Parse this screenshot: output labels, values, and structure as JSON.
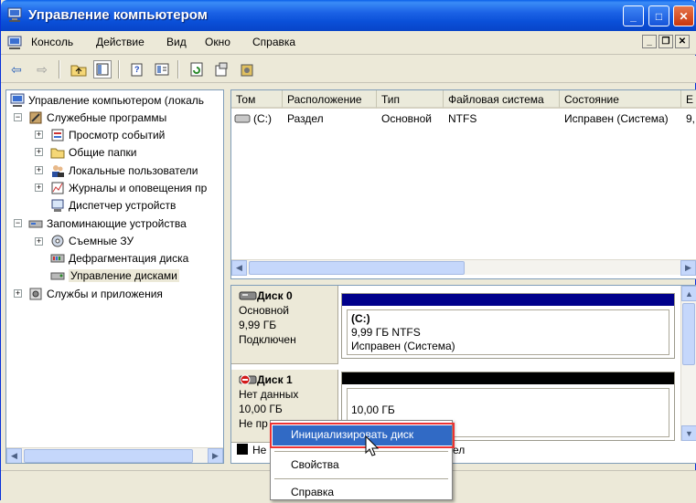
{
  "window": {
    "title": "Управление компьютером",
    "minimize": "_",
    "maximize": "□",
    "close": "✕"
  },
  "menu": {
    "items": [
      "Консоль",
      "Действие",
      "Вид",
      "Окно",
      "Справка"
    ]
  },
  "tree": {
    "root": "Управление компьютером (локаль",
    "items": [
      {
        "label": "Служебные программы",
        "icon": "tools-icon"
      },
      {
        "label": "Просмотр событий",
        "icon": "event-viewer-icon"
      },
      {
        "label": "Общие папки",
        "icon": "shared-folder-icon"
      },
      {
        "label": "Локальные пользователи",
        "icon": "users-icon"
      },
      {
        "label": "Журналы и оповещения пр",
        "icon": "logs-icon"
      },
      {
        "label": "Диспетчер устройств",
        "icon": "device-manager-icon"
      },
      {
        "label": "Запоминающие устройства",
        "icon": "storage-icon"
      },
      {
        "label": "Съемные ЗУ",
        "icon": "removable-storage-icon"
      },
      {
        "label": "Дефрагментация диска",
        "icon": "defrag-icon"
      },
      {
        "label": "Управление дисками",
        "icon": "disk-management-icon"
      },
      {
        "label": "Службы и приложения",
        "icon": "services-icon"
      }
    ]
  },
  "volumes": {
    "columns": [
      "Том",
      "Расположение",
      "Тип",
      "Файловая система",
      "Состояние",
      "Е"
    ],
    "rows": [
      {
        "tom": "(C:)",
        "loc": "Раздел",
        "type": "Основной",
        "fs": "NTFS",
        "state": "Исправен (Система)",
        "cap": "9,"
      }
    ]
  },
  "disks": [
    {
      "title": "Диск 0",
      "type": "Основной",
      "size": "9,99 ГБ",
      "status": "Подключен",
      "vol_name": "(C:)",
      "vol_size": "9,99 ГБ NTFS",
      "vol_state": "Исправен (Система)",
      "bar_color": "#00008b"
    },
    {
      "title": "Диск 1",
      "type": "Нет данных",
      "size": "10,00 ГБ",
      "status": "Не пр",
      "vol_size": "10,00 ГБ",
      "bar_color": "#000000"
    }
  ],
  "legend": {
    "left": "Не",
    "right": "ел"
  },
  "context_menu": {
    "items": [
      "Инициализировать диск",
      "Свойства",
      "Справка"
    ]
  },
  "colors": {
    "titlebar": "#0a4fd8",
    "highlight": "#316ac5",
    "primary_bar": "#00008b"
  }
}
